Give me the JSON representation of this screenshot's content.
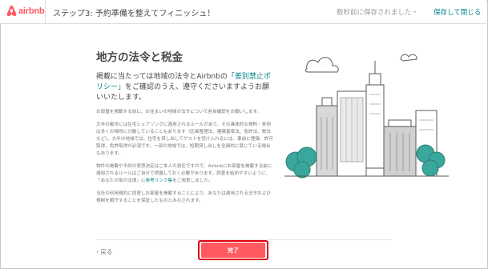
{
  "header": {
    "logo_text": "airbnb",
    "step_title": "ステップ3: 予約準備を整えてフィニッシュ！",
    "saved_text": "数秒前に保存されました・",
    "save_close": "保存して閉じる"
  },
  "main": {
    "title": "地方の法令と税金",
    "lead_part1": "掲載に当たっては地域の法令とAirbnbの",
    "lead_link": "「差別禁止ポリシー」",
    "lead_part2": "をご確認のうえ、遵守くださいますようお願いいたします。",
    "para1": "お部屋を掲載する前に、お住まいの地域の法令について各自確認をお願いします。",
    "para2": "大半の都市には住宅シェアリングに適用されるルールがあり、その具体的な規則・条例は多くの場所に分散していることもあります（区画整理法、建築基準法、免許法、税法など）。大半の地域では、住宅を貸し出してゲストを受け入れるには、事前に登録、許可取得、免許取得が必須です。一部の地域では、短期貸し出しを全面的に禁じている場合もあります。",
    "para3_part1": "物件の掲載や予約の意思決定はご本人の責任ですので、Airbnbにお部屋を掲載する前に適用されるルールはご自分で把握しておく必要があります。調査を始めやすいように、「あなたの街の法律」に",
    "para3_link": "参考リンク集",
    "para3_part2": "をご用意しました。",
    "para4": "当社の利用規約に同意しお部屋を掲載することにより、あなたは適用される法令および規制を順守することを保証したものとみなされます。"
  },
  "footer": {
    "back_label": "‹ 戻る",
    "done_label": "完了"
  },
  "colors": {
    "brand": "#ff5a5f",
    "link": "#008489",
    "highlight": "#e00010",
    "tree": "#3aa79c"
  },
  "icons": {
    "logo": "airbnb-logo-icon",
    "illustration": "city-buildings-illustration"
  }
}
